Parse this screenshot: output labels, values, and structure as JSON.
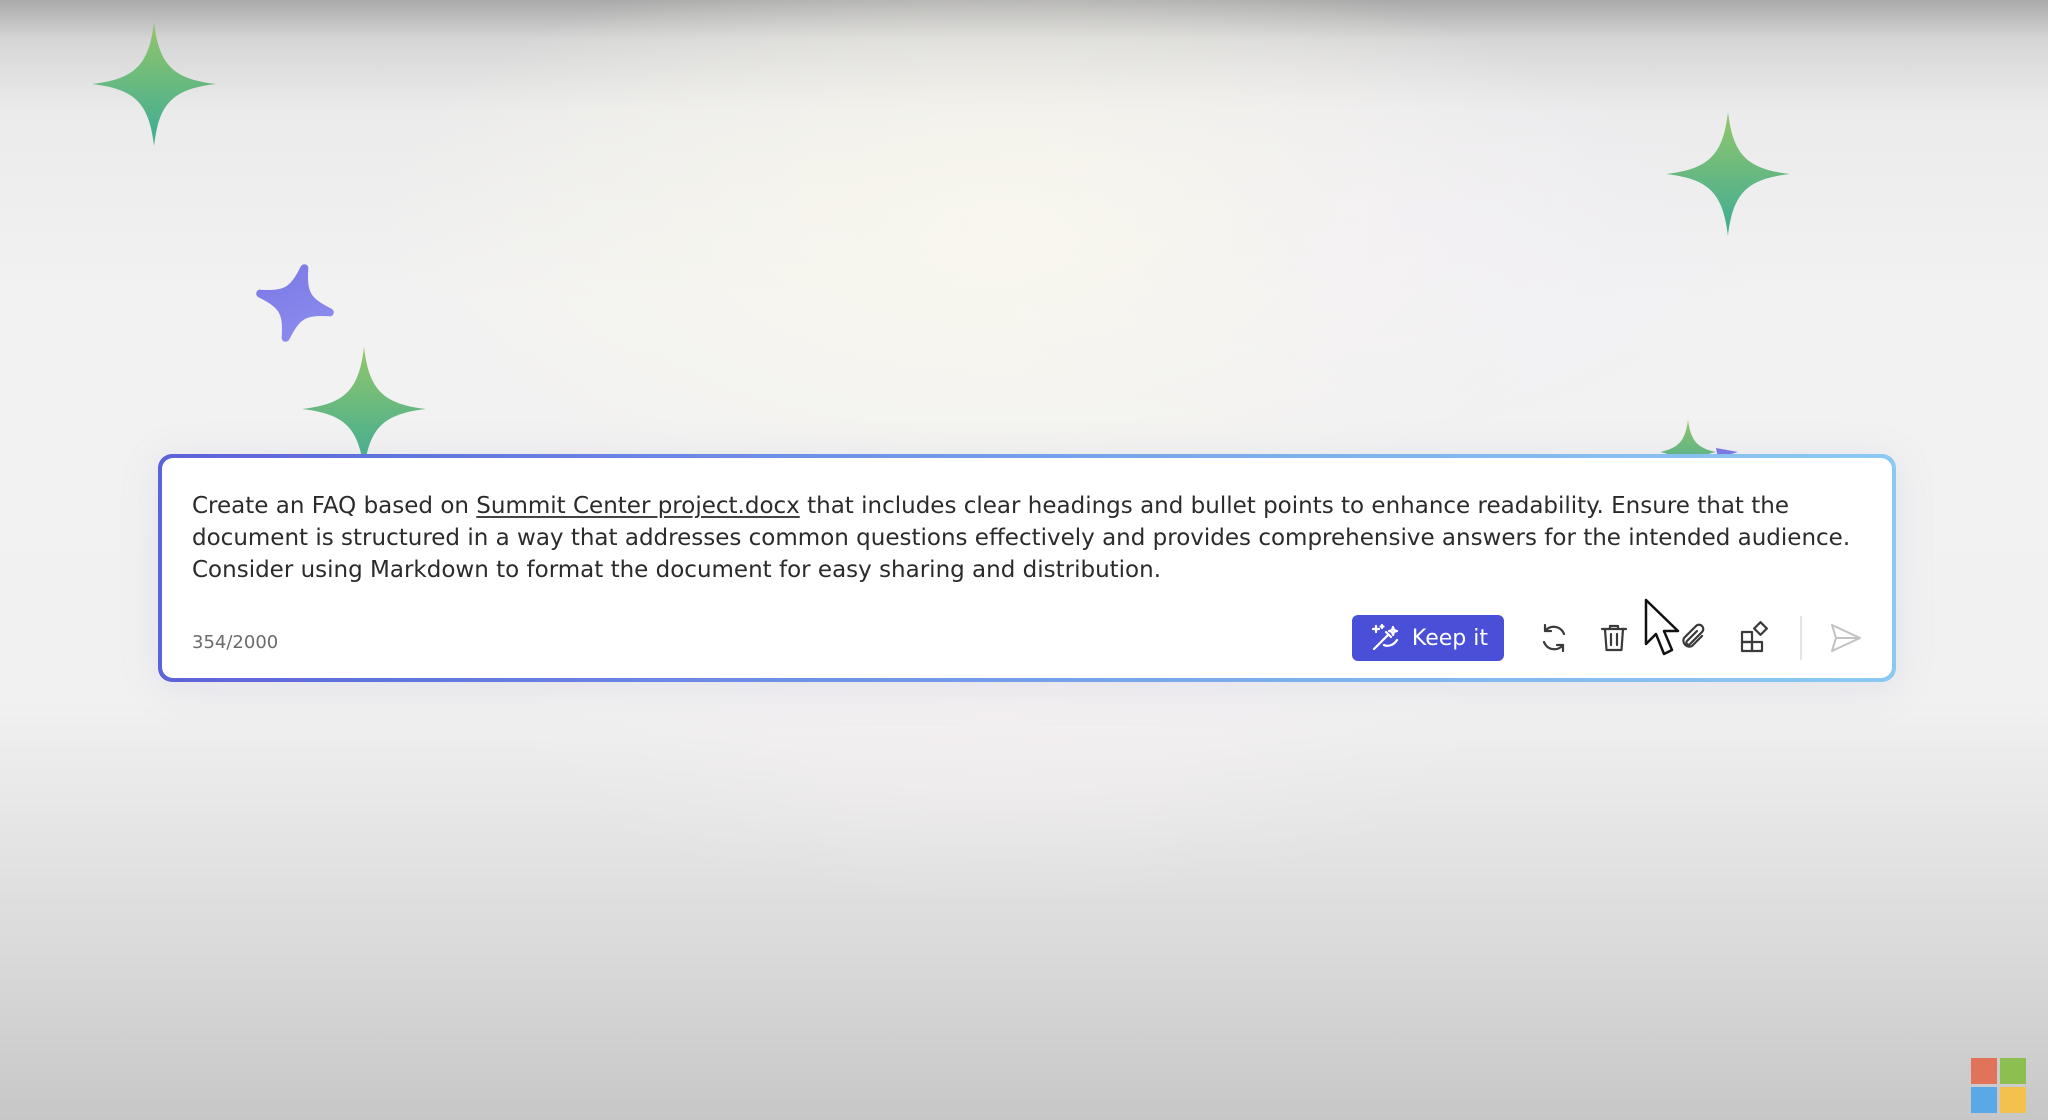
{
  "prompt": {
    "text_before_link": "Create an FAQ based on ",
    "file_link": "Summit Center project.docx",
    "text_after_link": " that includes clear headings and bullet points to enhance readability. Ensure that the document is structured in a way that addresses common questions effectively and provides comprehensive answers for the intended audience. Consider using Markdown to format the document for easy sharing and distribution."
  },
  "char_count": "354/2000",
  "toolbar": {
    "keep_label": "Keep it",
    "icons": [
      "keep-it-icon",
      "regenerate-icon",
      "trash-icon",
      "attach-icon",
      "add-apps-icon",
      "send-icon"
    ]
  },
  "colors": {
    "accent": "#4a4fd8",
    "border_start": "#5b63d8",
    "border_end": "#8bc9f2",
    "sparkle_green_top": "#8fc46c",
    "sparkle_green_bottom": "#3fae93",
    "sparkle_purple": "#7f7fe6",
    "ms_red": "#e1735a",
    "ms_green": "#8dbf50",
    "ms_blue": "#5aa9e6",
    "ms_yellow": "#f2c14e"
  }
}
